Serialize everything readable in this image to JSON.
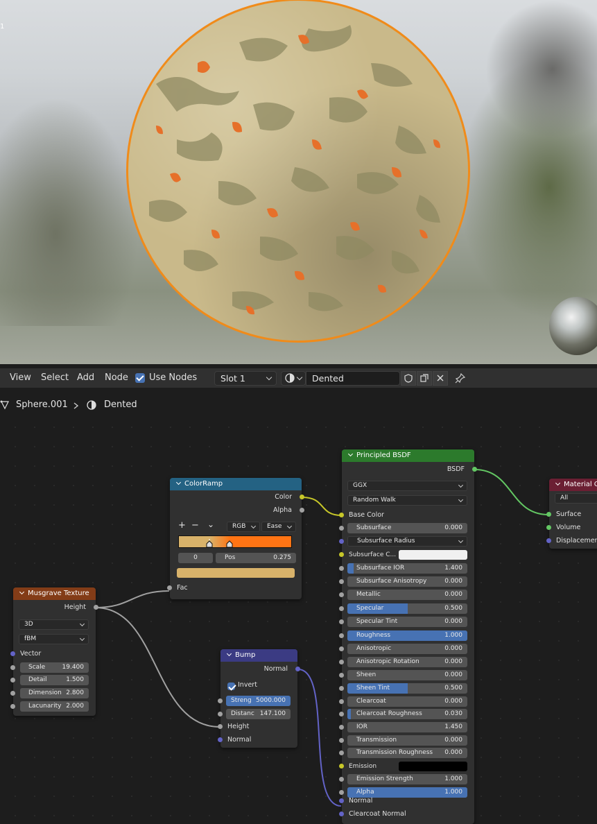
{
  "viewport": {
    "corner_text": "1"
  },
  "menubar": {
    "view": "View",
    "select": "Select",
    "add": "Add",
    "node": "Node",
    "use_nodes": "Use Nodes",
    "slot": "Slot 1",
    "material": "Dented"
  },
  "breadcrumb": {
    "object": "Sphere.001",
    "material": "Dented"
  },
  "nodes": {
    "colorramp": {
      "title": "ColorRamp",
      "out_color": "Color",
      "out_alpha": "Alpha",
      "add": "+",
      "remove": "−",
      "more": "⌄",
      "mode": "RGB",
      "interp": "Ease",
      "index": "0",
      "pos_label": "Pos",
      "pos_value": "0.275",
      "in_fac": "Fac",
      "color_left": "#d8b26a",
      "color_right": "#ff7414"
    },
    "musgrave": {
      "title": "Musgrave Texture",
      "out_height": "Height",
      "dim": "3D",
      "type": "fBM",
      "in_vector": "Vector",
      "scale_label": "Scale",
      "scale": "19.400",
      "detail_label": "Detail",
      "detail": "1.500",
      "dimension_label": "Dimension",
      "dimension": "2.800",
      "lacunarity_label": "Lacunarity",
      "lacunarity": "2.000"
    },
    "bump": {
      "title": "Bump",
      "out_normal": "Normal",
      "invert": "Invert",
      "strength_label": "Streng",
      "strength": "5000.000",
      "distance_label": "Distanc",
      "distance": "147.100",
      "in_height": "Height",
      "in_normal": "Normal"
    },
    "bsdf": {
      "title": "Principled BSDF",
      "out_bsdf": "BSDF",
      "distribution": "GGX",
      "subsurface_method": "Random Walk",
      "base_color": "Base Color",
      "rows": [
        {
          "label": "Subsurface",
          "value": "0.000",
          "fill": 0
        },
        {
          "label": "Subsurface Radius",
          "value": "",
          "fill": 0
        },
        {
          "label": "Subsurface C...",
          "value": "",
          "fill": 0
        },
        {
          "label": "Subsurface IOR",
          "value": "1.400",
          "fill": 0.05
        },
        {
          "label": "Subsurface Anisotropy",
          "value": "0.000",
          "fill": 0
        },
        {
          "label": "Metallic",
          "value": "0.000",
          "fill": 0
        },
        {
          "label": "Specular",
          "value": "0.500",
          "fill": 0.5
        },
        {
          "label": "Specular Tint",
          "value": "0.000",
          "fill": 0
        },
        {
          "label": "Roughness",
          "value": "1.000",
          "fill": 1
        },
        {
          "label": "Anisotropic",
          "value": "0.000",
          "fill": 0
        },
        {
          "label": "Anisotropic Rotation",
          "value": "0.000",
          "fill": 0
        },
        {
          "label": "Sheen",
          "value": "0.000",
          "fill": 0
        },
        {
          "label": "Sheen Tint",
          "value": "0.500",
          "fill": 0.5
        },
        {
          "label": "Clearcoat",
          "value": "0.000",
          "fill": 0
        },
        {
          "label": "Clearcoat Roughness",
          "value": "0.030",
          "fill": 0.03
        },
        {
          "label": "IOR",
          "value": "1.450",
          "fill": 0
        },
        {
          "label": "Transmission",
          "value": "0.000",
          "fill": 0
        },
        {
          "label": "Transmission Roughness",
          "value": "0.000",
          "fill": 0
        },
        {
          "label": "Emission",
          "value": "",
          "fill": 0
        },
        {
          "label": "Emission Strength",
          "value": "1.000",
          "fill": 0
        },
        {
          "label": "Alpha",
          "value": "1.000",
          "fill": 1
        }
      ],
      "normal": "Normal",
      "clearcoat_normal": "Clearcoat Normal"
    },
    "output": {
      "title": "Material Out",
      "target": "All",
      "surface": "Surface",
      "volume": "Volume",
      "displacement": "Displacement"
    }
  },
  "colors": {
    "accent": "#4772b3",
    "sphere_outline": "#f08b1a",
    "header_colorramp": "#246283",
    "header_musgrave": "#833c17",
    "header_bump": "#3b3b83",
    "header_bsdf": "#2c7a2c",
    "header_output": "#6b1f33"
  }
}
